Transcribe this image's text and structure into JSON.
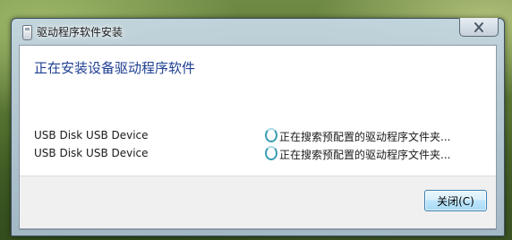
{
  "window": {
    "title": "驱动程序软件安装"
  },
  "main": {
    "heading": "正在安装设备驱动程序软件",
    "devices": [
      {
        "name": "USB Disk USB Device",
        "status": "正在搜索预配置的驱动程序文件夹..."
      },
      {
        "name": "USB Disk USB Device",
        "status": "正在搜索预配置的驱动程序文件夹..."
      }
    ]
  },
  "footer": {
    "close_label": "关闭(C)"
  },
  "icons": {
    "app": "driver-install-icon",
    "titlebar_close": "close-icon",
    "status": "spinner-icon"
  },
  "colors": {
    "heading": "#1e3f91",
    "spinner": "#3a9db3"
  }
}
